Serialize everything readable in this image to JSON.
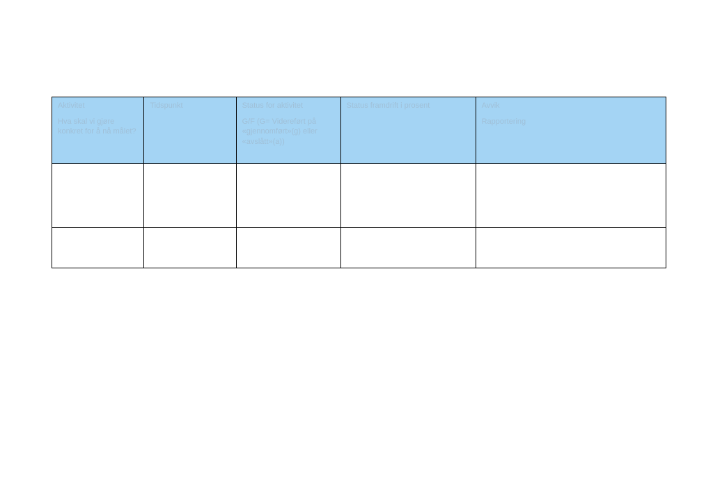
{
  "table": {
    "headers": [
      {
        "main": "Aktivitet",
        "sub": "Hva skal vi gjøre konkret for å nå målet?"
      },
      {
        "main": "Tidspunkt",
        "sub": ""
      },
      {
        "main": "Status for aktivitet",
        "sub": "G/F (G= Videreført på «gjennomført»(g) eller «avslått»(a))"
      },
      {
        "main": "Status framdrift i prosent",
        "sub": ""
      },
      {
        "main": "Avvik",
        "sub": "Rapportering"
      }
    ],
    "rows": [
      [
        "",
        "",
        "",
        "",
        ""
      ],
      [
        "",
        "",
        "",
        "",
        ""
      ]
    ]
  }
}
